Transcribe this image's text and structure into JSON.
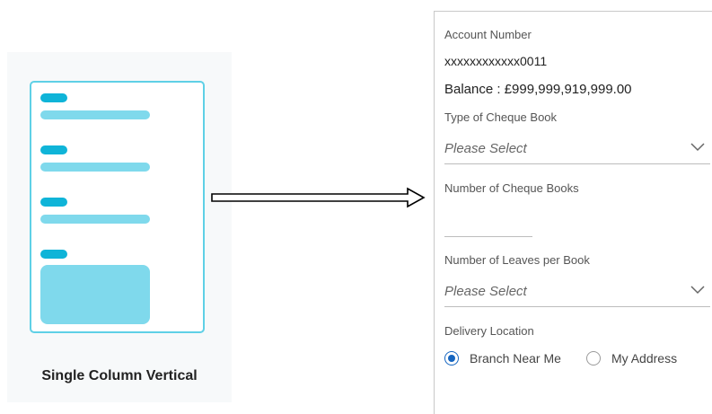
{
  "illustration": {
    "caption": "Single Column Vertical"
  },
  "form": {
    "account_label": "Account Number",
    "account_value": "xxxxxxxxxxxx0011",
    "balance": "Balance : £999,999,919,999.00",
    "cheque_type_label": "Type of Cheque Book",
    "cheque_type_placeholder": "Please Select",
    "num_books_label": "Number of Cheque Books",
    "num_books_value": "",
    "leaves_label": "Number of Leaves per Book",
    "leaves_placeholder": "Please Select",
    "delivery_label": "Delivery Location",
    "delivery_options": [
      {
        "label": "Branch Near Me",
        "selected": true
      },
      {
        "label": "My Address",
        "selected": false
      }
    ]
  },
  "colors": {
    "accent": "#0fb4d8",
    "accent_light": "#7fd9ec",
    "radio_selected": "#1565c0"
  },
  "icons": [
    "chevron-down-icon",
    "right-arrow-icon",
    "radio-selected-icon",
    "radio-unselected-icon"
  ]
}
